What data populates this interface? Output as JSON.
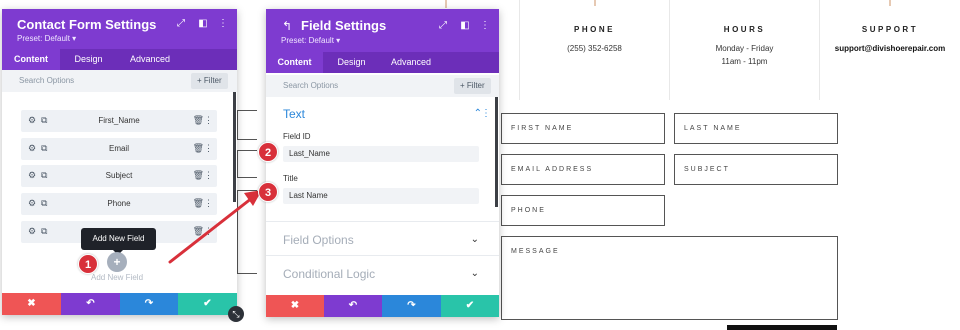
{
  "info": [
    {
      "title": "PHONE",
      "value": "(255) 352-6258"
    },
    {
      "title": "HOURS",
      "value": "Monday - Friday",
      "value2": "11am - 11pm"
    },
    {
      "title": "SUPPORT",
      "value": "support@divishoerepair.com"
    }
  ],
  "form_fields": {
    "first_name": "FIRST NAME",
    "last_name": "LAST NAME",
    "email": "EMAIL ADDRESS",
    "subject": "SUBJECT",
    "phone": "PHONE",
    "message": "MESSAGE"
  },
  "left_panel": {
    "title": "Contact Form Settings",
    "preset": "Preset: Default ▾",
    "tabs": [
      "Content",
      "Design",
      "Advanced"
    ],
    "search_placeholder": "Search Options",
    "filter_label": "+ Filter",
    "items": [
      "First_Name",
      "Email",
      "Subject",
      "Phone",
      ""
    ],
    "tooltip": "Add New Field",
    "add_label": "Add New Field",
    "add_symbol": "+"
  },
  "right_panel": {
    "title": "Field Settings",
    "preset": "Preset: Default ▾",
    "tabs": [
      "Content",
      "Design",
      "Advanced"
    ],
    "search_placeholder": "Search Options",
    "filter_label": "+ Filter",
    "section_text": "Text",
    "field_id_label": "Field ID",
    "field_id_value": "Last_Name",
    "title_label": "Title",
    "title_value": "Last Name",
    "section_options": "Field Options",
    "section_logic": "Conditional Logic"
  },
  "badges": [
    "1",
    "2",
    "3"
  ],
  "colors": {
    "purple": "#7e3bd0",
    "purple_dark": "#6c2eb9",
    "red": "#ef5555",
    "violet": "#7e3bd0",
    "blue": "#2b87da",
    "green": "#29c4a9",
    "badge": "#d8303a",
    "arrow": "#d8303a"
  }
}
